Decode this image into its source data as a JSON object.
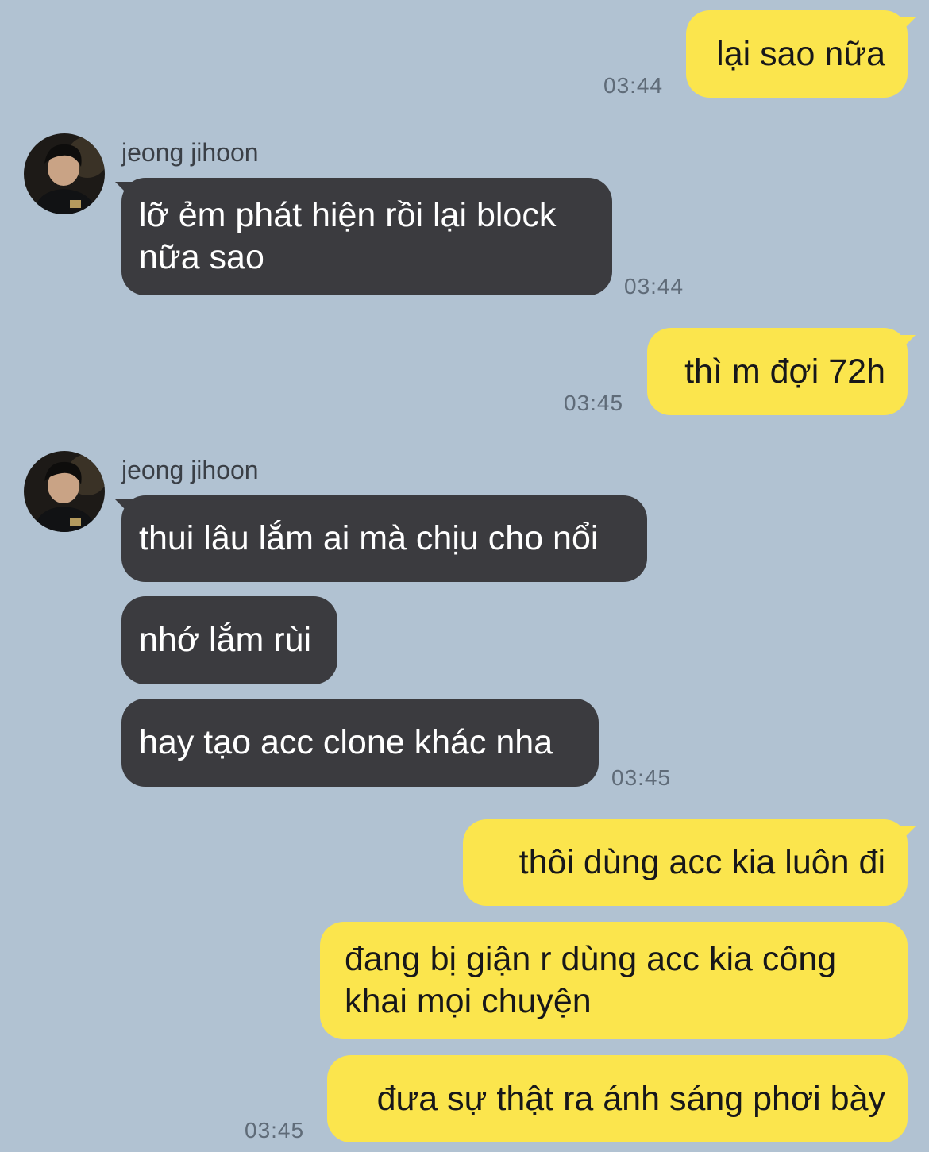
{
  "chat": {
    "contact_name": "jeong jihoon",
    "messages": [
      {
        "from": "me",
        "text": "lại sao nữa",
        "time": "03:44"
      },
      {
        "from": "them",
        "text": "lỡ ẻm phát hiện rồi lại block nữa sao",
        "time": "03:44"
      },
      {
        "from": "me",
        "text": "thì m đợi 72h",
        "time": "03:45"
      },
      {
        "from": "them",
        "text": "thui lâu lắm ai mà chịu cho nổi",
        "time": ""
      },
      {
        "from": "them",
        "text": "nhớ lắm rùi",
        "time": ""
      },
      {
        "from": "them",
        "text": "hay tạo acc clone khác nha",
        "time": "03:45"
      },
      {
        "from": "me",
        "text": "thôi dùng acc kia luôn đi",
        "time": ""
      },
      {
        "from": "me",
        "text": "đang bị giận r dùng acc kia công khai mọi chuyện",
        "time": ""
      },
      {
        "from": "me",
        "text": "đưa sự thật ra ánh sáng phơi bày",
        "time": "03:45"
      }
    ]
  },
  "colors": {
    "background": "#b1c2d2",
    "my_bubble": "#fbe54d",
    "their_bubble": "#3b3b3f",
    "timestamp": "#5f6b78"
  },
  "icons": {
    "avatar": "contact-profile-photo"
  }
}
